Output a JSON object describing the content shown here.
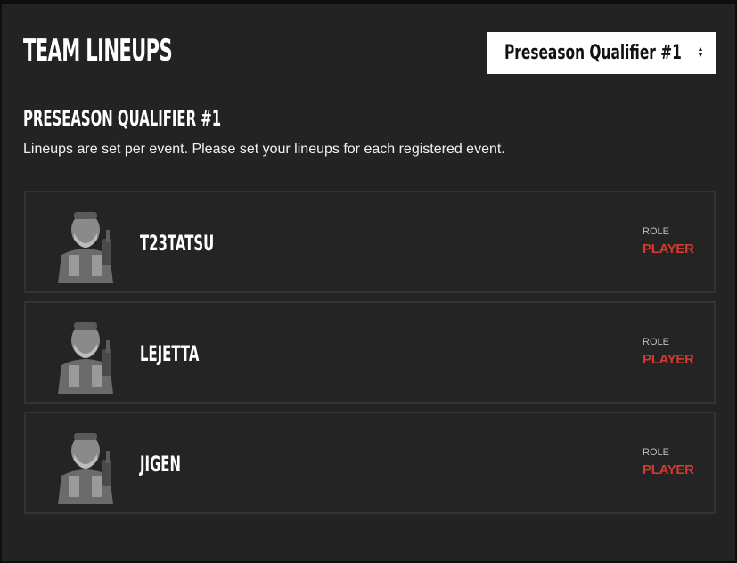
{
  "header": {
    "title": "TEAM LINEUPS"
  },
  "event_select": {
    "selected": "Preseason Qualifier #1"
  },
  "event": {
    "title": "PRESEASON QUALIFIER #1",
    "description": "Lineups are set per event. Please set your lineups for each registered event."
  },
  "players": [
    {
      "name": "T23TATSU",
      "role_label": "ROLE",
      "role": "PLAYER",
      "avatar_icon": "character-portrait-icon"
    },
    {
      "name": "LEJETTA",
      "role_label": "ROLE",
      "role": "PLAYER",
      "avatar_icon": "character-portrait-icon"
    },
    {
      "name": "JIGEN",
      "role_label": "ROLE",
      "role": "PLAYER",
      "avatar_icon": "character-portrait-icon"
    }
  ],
  "colors": {
    "background": "#232323",
    "card_border": "#333333",
    "role_accent": "#d43a2f",
    "select_bg": "#ffffff"
  }
}
